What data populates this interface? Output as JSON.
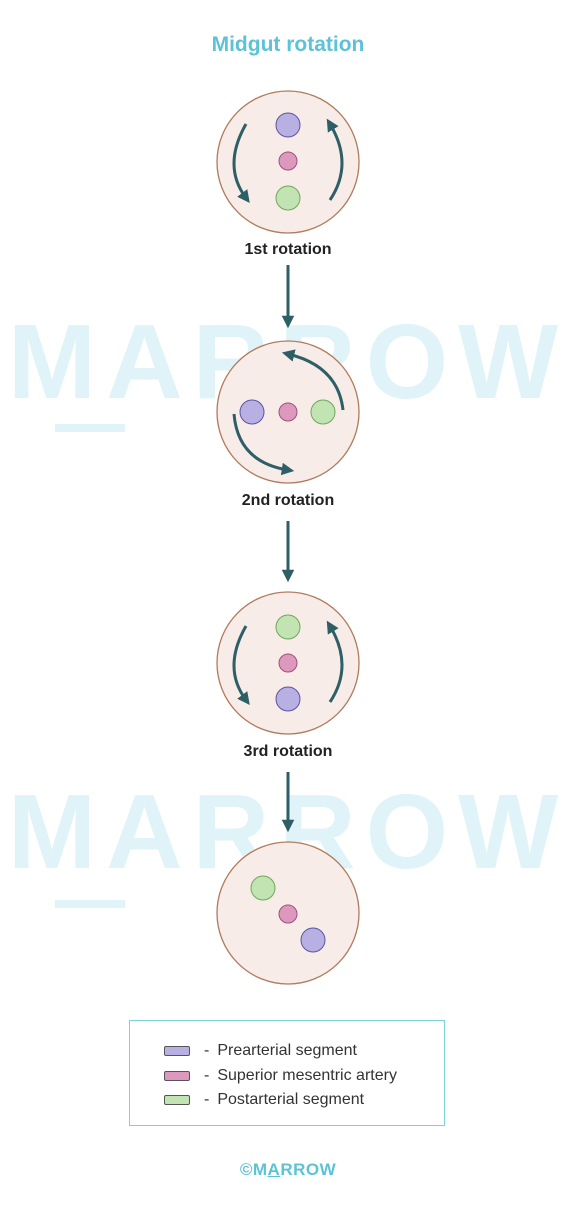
{
  "title": "Midgut rotation",
  "steps": [
    {
      "label": "1st rotation"
    },
    {
      "label": "2nd rotation"
    },
    {
      "label": "3rd rotation"
    },
    {
      "label": ""
    }
  ],
  "legend": {
    "items": [
      {
        "dash": "-",
        "label": "Prearterial segment",
        "color": "#b8b0e3"
      },
      {
        "dash": "-",
        "label": "Superior mesentric artery",
        "color": "#dc98bd"
      },
      {
        "dash": "-",
        "label": "Postarterial segment",
        "color": "#c2e3b2"
      }
    ]
  },
  "watermark": "MARROW",
  "footer": {
    "symbol": "©",
    "first": "M",
    "second": "A",
    "rest": "RROW"
  },
  "colors": {
    "accent": "#5cc3d6",
    "circle_fill": "#f7ece8",
    "circle_stroke": "#b07a5c",
    "arrow": "#2f5f66",
    "watermark": "#dff3f8"
  }
}
